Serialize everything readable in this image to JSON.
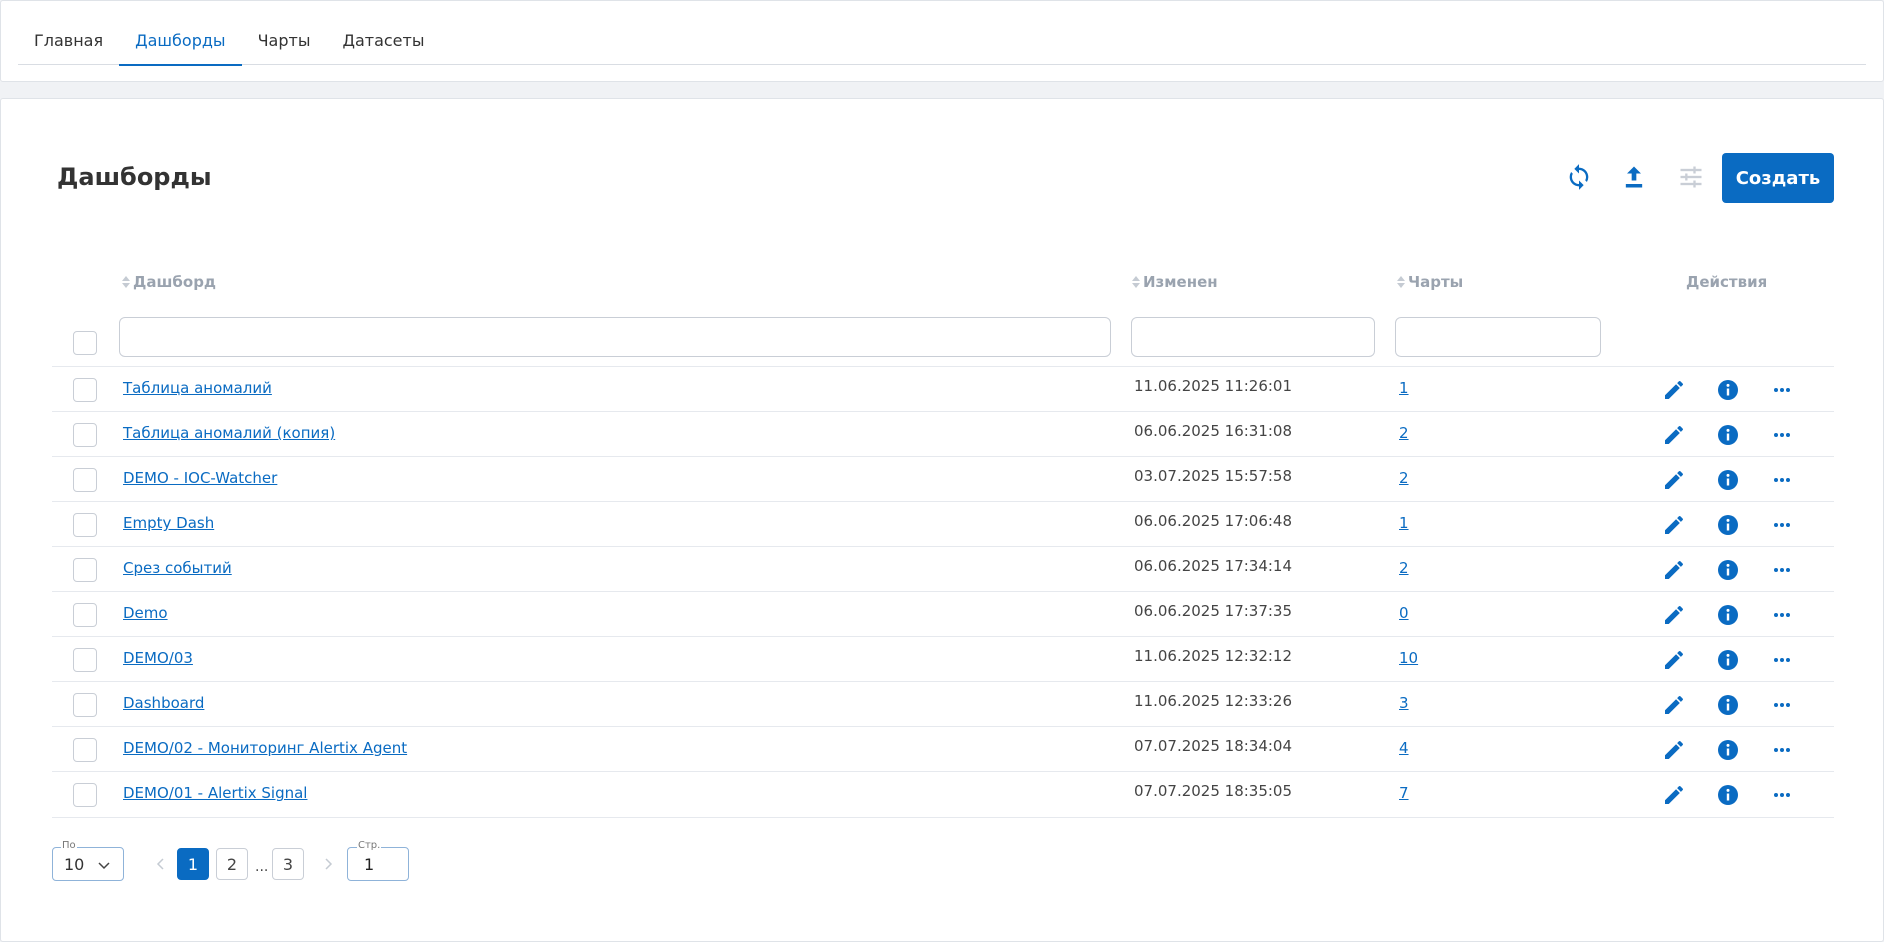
{
  "nav": {
    "tabs": [
      {
        "label": "Главная"
      },
      {
        "label": "Дашборды"
      },
      {
        "label": "Чарты"
      },
      {
        "label": "Датасеты"
      }
    ],
    "active_tab": "Дашборды"
  },
  "page": {
    "title": "Дашборды",
    "create_label": "Создать"
  },
  "toolbar": {
    "icons": [
      "refresh-icon",
      "upload-icon",
      "filter-settings-icon"
    ]
  },
  "table": {
    "headers": {
      "name": "Дашборд",
      "modified": "Изменен",
      "charts": "Чарты",
      "actions": "Действия"
    },
    "filters": {
      "name": "",
      "modified": "",
      "charts": ""
    },
    "rows": [
      {
        "name": "Таблица аномалий",
        "modified": "11.06.2025 11:26:01",
        "charts": "1"
      },
      {
        "name": "Таблица аномалий (копия)",
        "modified": "06.06.2025 16:31:08",
        "charts": "2"
      },
      {
        "name": "DEMO - IOC-Watcher",
        "modified": "03.07.2025 15:57:58",
        "charts": "2"
      },
      {
        "name": "Empty Dash",
        "modified": "06.06.2025 17:06:48",
        "charts": "1"
      },
      {
        "name": "Срез событий",
        "modified": "06.06.2025 17:34:14",
        "charts": "2"
      },
      {
        "name": "Demo",
        "modified": "06.06.2025 17:37:35",
        "charts": "0"
      },
      {
        "name": "DEMO/03",
        "modified": "11.06.2025 12:32:12",
        "charts": "10"
      },
      {
        "name": "Dashboard",
        "modified": "11.06.2025 12:33:26",
        "charts": "3"
      },
      {
        "name": "DEMO/02 - Мониторинг Alertix Agent",
        "modified": "07.07.2025 18:34:04",
        "charts": "4"
      },
      {
        "name": "DEMO/01 - Alertix Signal",
        "modified": "07.07.2025 18:35:05",
        "charts": "7"
      }
    ],
    "row_actions": [
      "edit-icon",
      "info-icon",
      "more-icon"
    ]
  },
  "pagination": {
    "per_page_label": "По",
    "per_page_value": "10",
    "pages": [
      "1",
      "2",
      "3"
    ],
    "ellipsis": "...",
    "current_page": "1",
    "goto_label": "Стр.",
    "goto_value": "1"
  },
  "colors": {
    "accent": "#0a6bc2",
    "muted_header": "#9aa3af",
    "border": "#c9ced6"
  }
}
